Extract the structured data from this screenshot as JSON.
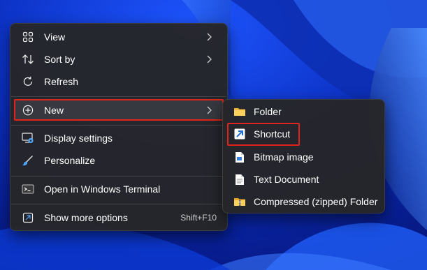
{
  "context_menu": {
    "items": [
      {
        "label": "View",
        "icon": "view-grid-icon",
        "has_submenu": true
      },
      {
        "label": "Sort by",
        "icon": "sort-arrows-icon",
        "has_submenu": true
      },
      {
        "label": "Refresh",
        "icon": "refresh-icon",
        "has_submenu": false
      },
      {
        "label": "New",
        "icon": "new-plus-circle-icon",
        "has_submenu": true,
        "highlighted": true
      },
      {
        "label": "Display settings",
        "icon": "display-settings-icon",
        "has_submenu": false
      },
      {
        "label": "Personalize",
        "icon": "brush-icon",
        "has_submenu": false
      },
      {
        "label": "Open in Windows Terminal",
        "icon": "terminal-icon",
        "has_submenu": false
      },
      {
        "label": "Show more options",
        "icon": "show-more-options-icon",
        "has_submenu": false,
        "shortcut": "Shift+F10"
      }
    ]
  },
  "new_submenu": {
    "items": [
      {
        "label": "Folder",
        "icon": "folder-icon"
      },
      {
        "label": "Shortcut",
        "icon": "shortcut-arrow-icon",
        "highlighted": true
      },
      {
        "label": "Bitmap image",
        "icon": "bitmap-image-icon"
      },
      {
        "label": "Text Document",
        "icon": "text-document-icon"
      },
      {
        "label": "Compressed (zipped) Folder",
        "icon": "zipped-folder-icon"
      }
    ]
  },
  "colors": {
    "menu_background": "#262628",
    "highlight_outline": "#e0241b",
    "accent_blue": "#4fa6ff",
    "wallpaper_blue": "#0a2fb8"
  }
}
